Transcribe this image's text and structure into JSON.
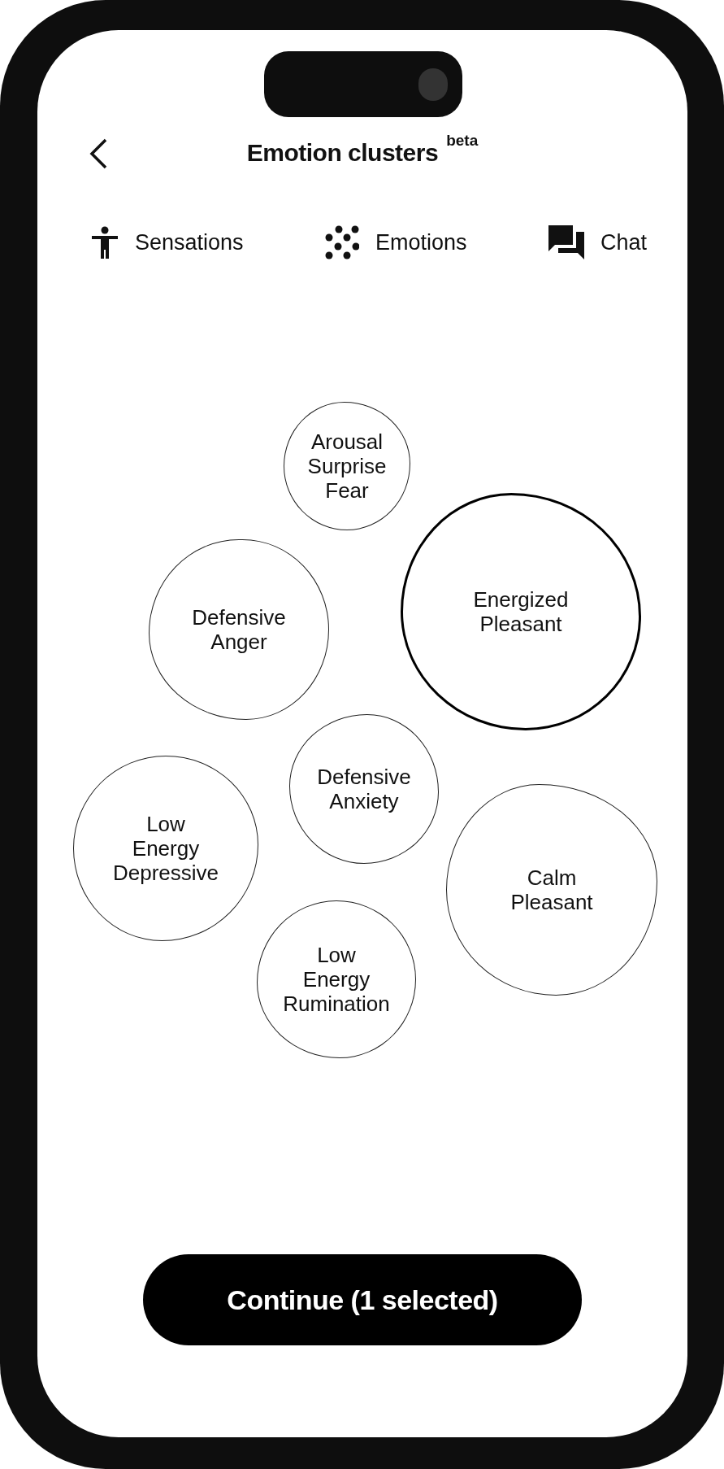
{
  "header": {
    "title": "Emotion clusters",
    "badge": "beta"
  },
  "tabs": [
    {
      "label": "Sensations",
      "kind": "body"
    },
    {
      "label": "Emotions",
      "kind": "dots"
    },
    {
      "label": "Chat",
      "kind": "chat"
    }
  ],
  "clusters": [
    {
      "lines": [
        "Arousal",
        "Surprise",
        "Fear"
      ],
      "selected": false
    },
    {
      "lines": [
        "Defensive",
        "Anger"
      ],
      "selected": false
    },
    {
      "lines": [
        "Energized",
        "Pleasant"
      ],
      "selected": true
    },
    {
      "lines": [
        "Defensive",
        "Anxiety"
      ],
      "selected": false
    },
    {
      "lines": [
        "Low",
        "Energy",
        "Depressive"
      ],
      "selected": false
    },
    {
      "lines": [
        "Calm",
        "Pleasant"
      ],
      "selected": false
    },
    {
      "lines": [
        "Low",
        "Energy",
        "Rumination"
      ],
      "selected": false
    }
  ],
  "continue_button": "Continue (1 selected)"
}
